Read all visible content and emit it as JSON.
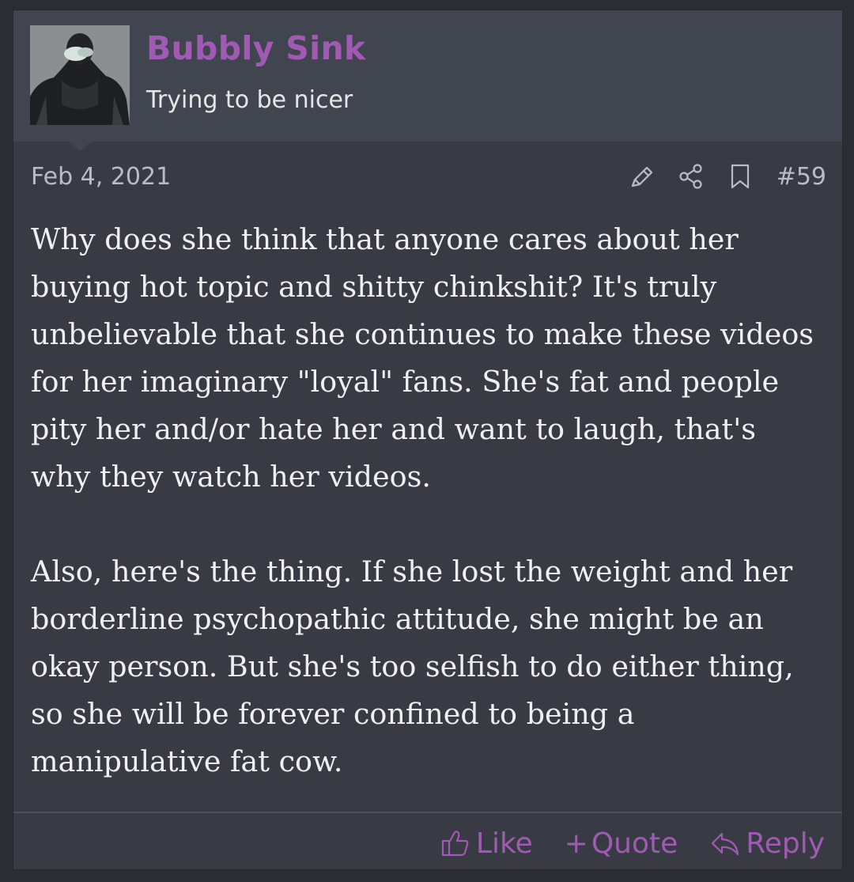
{
  "user": {
    "name": "Bubbly Sink",
    "title": "Trying to be nicer",
    "avatar_icon": "user-avatar-image"
  },
  "post": {
    "date": "Feb 4, 2021",
    "number": "#59",
    "paragraphs": [
      "Why does she think that anyone cares about her buying hot topic and shitty chinkshit? It's truly unbelievable that she continues to make these videos for her imaginary \"loyal\" fans. She's fat and people pity her and/or hate her and want to laugh, that's why they watch her videos.",
      "Also, here's the thing. If she lost the weight and her borderline psychopathic attitude, she might be an okay person. But she's too selfish to do either thing, so she will be forever confined to being a manipulative fat cow."
    ],
    "header_icons": [
      "edit-icon",
      "share-icon",
      "bookmark-icon"
    ]
  },
  "footer": {
    "like_label": "Like",
    "quote_label": "Quote",
    "reply_label": "Reply"
  },
  "colors": {
    "accent": "#a15ab3",
    "background": "#383b43",
    "header_bg": "#414550",
    "text": "#eef0f2",
    "muted": "#b9bcc2"
  }
}
